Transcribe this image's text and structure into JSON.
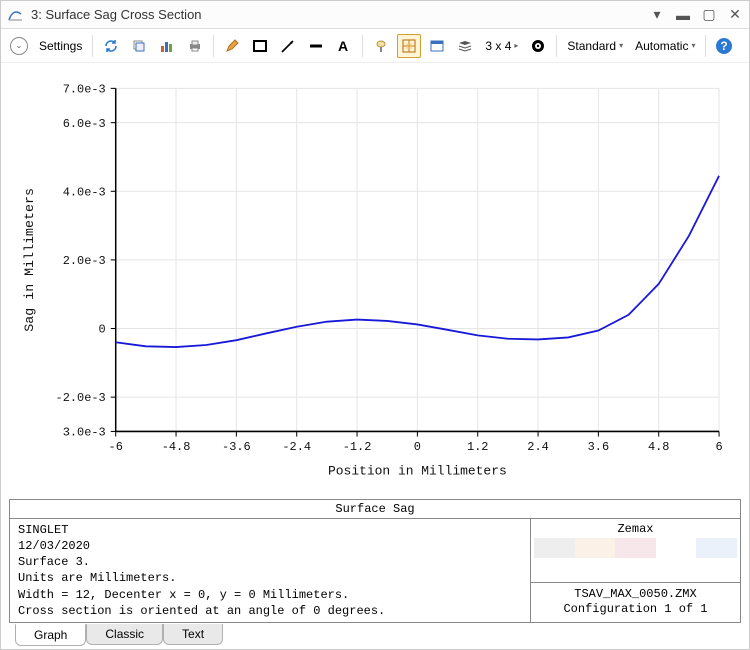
{
  "window": {
    "title": "3: Surface Sag Cross Section",
    "settings_label": "Settings",
    "grid_label": "3 x 4",
    "dropdown1": "Standard",
    "dropdown2": "Automatic"
  },
  "chart_data": {
    "type": "line",
    "xlabel": "Position in Millimeters",
    "ylabel": "Sag in Millimeters",
    "xlim": [
      -6.0,
      6.0
    ],
    "ylim": [
      -0.003,
      0.007
    ],
    "xticks": [
      -6.0,
      -4.8,
      -3.6,
      -2.4,
      -1.2,
      0,
      1.2,
      2.4,
      3.6,
      4.8,
      6.0
    ],
    "yticks": [
      -0.003,
      -0.002,
      0,
      0.002,
      0.004,
      0.006,
      0.007
    ],
    "ytick_labels": [
      "3.0e-3",
      "-2.0e-3",
      "0",
      "2.0e-3",
      "4.0e-3",
      "6.0e-3",
      "7.0e-3"
    ],
    "series": [
      {
        "name": "Sag",
        "color": "#1818d8",
        "x": [
          -6.0,
          -5.4,
          -4.8,
          -4.2,
          -3.6,
          -3.0,
          -2.4,
          -1.8,
          -1.2,
          -0.6,
          0.0,
          0.6,
          1.2,
          1.8,
          2.4,
          3.0,
          3.6,
          4.2,
          4.8,
          5.4,
          6.0
        ],
        "y": [
          -0.0004,
          -0.00052,
          -0.00054,
          -0.00048,
          -0.00034,
          -0.00014,
          5e-05,
          0.0002,
          0.00026,
          0.00022,
          0.00012,
          -4e-05,
          -0.0002,
          -0.0003,
          -0.00032,
          -0.00026,
          -6e-05,
          0.0004,
          0.0013,
          0.0027,
          0.00445
        ]
      }
    ]
  },
  "info": {
    "title": "Surface Sag",
    "lines": [
      "SINGLET",
      "12/03/2020",
      "Surface 3.",
      "Units are Millimeters.",
      "Width = 12, Decenter x = 0, y = 0 Millimeters.",
      "Cross section is oriented at an angle of 0 degrees."
    ],
    "brand": "Zemax",
    "filename": "TSAV_MAX_0050.ZMX",
    "config": "Configuration 1 of 1"
  },
  "tabs": [
    "Graph",
    "Classic",
    "Text"
  ],
  "active_tab": 0
}
